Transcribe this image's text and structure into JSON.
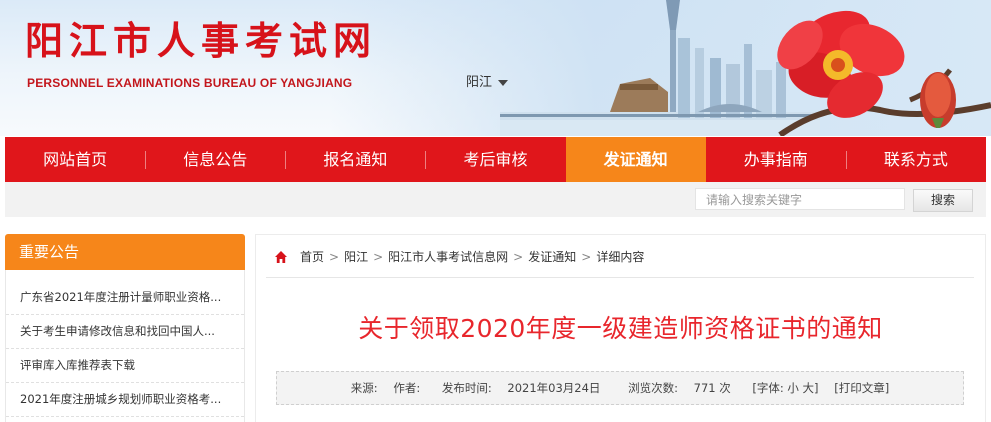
{
  "header": {
    "title": "阳江市人事考试网",
    "subtitle": "PERSONNEL EXAMINATIONS BUREAU OF YANGJIANG",
    "region": "阳江"
  },
  "nav": {
    "items": [
      {
        "label": "网站首页"
      },
      {
        "label": "信息公告"
      },
      {
        "label": "报名通知"
      },
      {
        "label": "考后审核"
      },
      {
        "label": "发证通知",
        "active": true
      },
      {
        "label": "办事指南"
      },
      {
        "label": "联系方式"
      }
    ]
  },
  "search": {
    "placeholder": "请输入搜索关键字",
    "button_label": "搜索"
  },
  "sidebar": {
    "heading": "重要公告",
    "items": [
      {
        "label": "广东省2021年度注册计量师职业资格..."
      },
      {
        "label": "关于考生申请修改信息和找回中国人..."
      },
      {
        "label": "评审库入库推荐表下载"
      },
      {
        "label": "2021年度注册城乡规划师职业资格考..."
      }
    ]
  },
  "breadcrumb": [
    "首页",
    "阳江",
    "阳江市人事考试信息网",
    "发证通知",
    "详细内容"
  ],
  "article": {
    "title": "关于领取2020年度一级建造师资格证书的通知",
    "meta": {
      "source_label": "来源:",
      "author_label": "作者:",
      "publish_label": "发布时间:",
      "publish_date": "2021年03月24日",
      "views_label": "浏览次数:",
      "views_count": "771 次",
      "font_size": "[字体: 小 大]",
      "print": "[打印文章]"
    }
  },
  "colors": {
    "brand_red": "#e0161b",
    "accent_orange": "#f6861a",
    "title_red": "#e8262c"
  }
}
